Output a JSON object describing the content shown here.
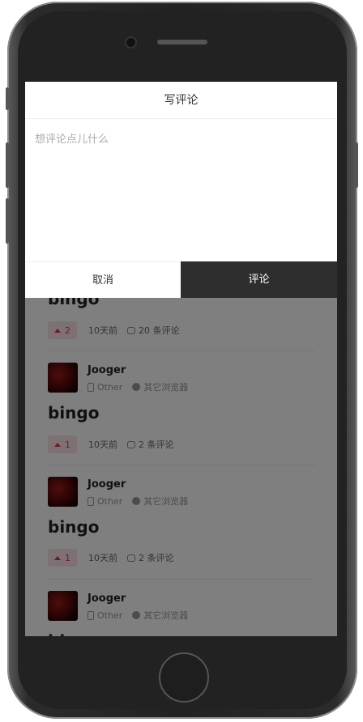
{
  "dialog": {
    "title": "写评论",
    "placeholder": "想评论点儿什么",
    "cancel": "取消",
    "submit": "评论"
  },
  "posts": [
    {
      "title": "bingo",
      "likes": "2",
      "time": "10天前",
      "comments": "20 条评论"
    },
    {
      "user": "Jooger",
      "device": "Other",
      "browser": "其它浏览器",
      "title": "bingo",
      "likes": "1",
      "time": "10天前",
      "comments": "2 条评论"
    },
    {
      "user": "Jooger",
      "device": "Other",
      "browser": "其它浏览器",
      "title": "bingo",
      "likes": "1",
      "time": "10天前",
      "comments": "2 条评论"
    },
    {
      "user": "Jooger",
      "device": "Other",
      "browser": "其它浏览器",
      "title": "bingo"
    }
  ],
  "colors": {
    "accent": "#e0334d",
    "submit_bg": "#2e2e2e"
  }
}
